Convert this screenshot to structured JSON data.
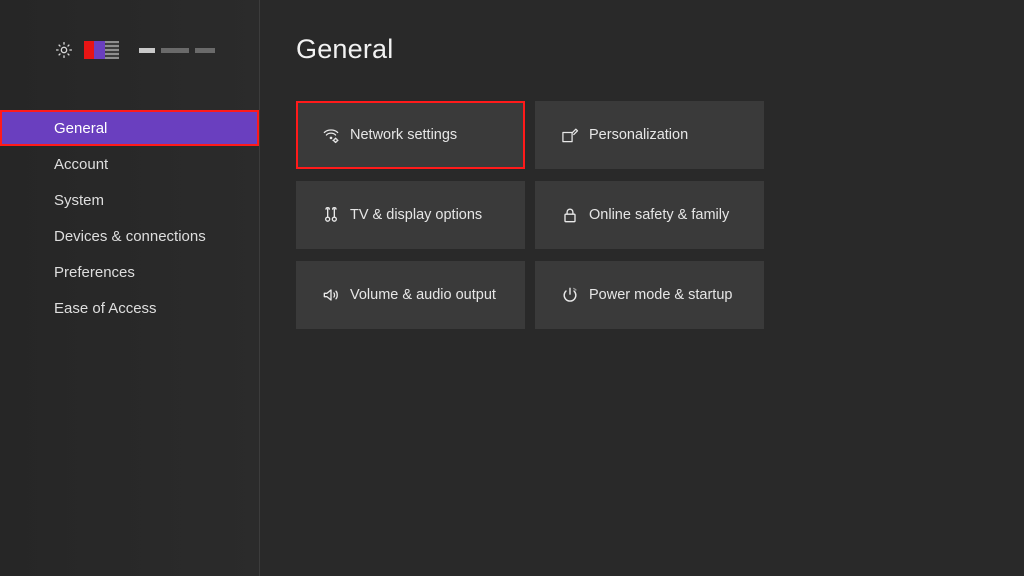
{
  "page": {
    "title": "General"
  },
  "sidebar": {
    "items": [
      {
        "label": "General",
        "active": true
      },
      {
        "label": "Account",
        "active": false
      },
      {
        "label": "System",
        "active": false
      },
      {
        "label": "Devices & connections",
        "active": false
      },
      {
        "label": "Preferences",
        "active": false
      },
      {
        "label": "Ease of Access",
        "active": false
      }
    ]
  },
  "tiles": [
    {
      "icon": "network",
      "label": "Network settings",
      "highlight": true
    },
    {
      "icon": "personal",
      "label": "Personalization",
      "highlight": false
    },
    {
      "icon": "display",
      "label": "TV & display options",
      "highlight": false
    },
    {
      "icon": "lock",
      "label": "Online safety & family",
      "highlight": false
    },
    {
      "icon": "audio",
      "label": "Volume & audio output",
      "highlight": false
    },
    {
      "icon": "power",
      "label": "Power mode & startup",
      "highlight": false
    }
  ]
}
